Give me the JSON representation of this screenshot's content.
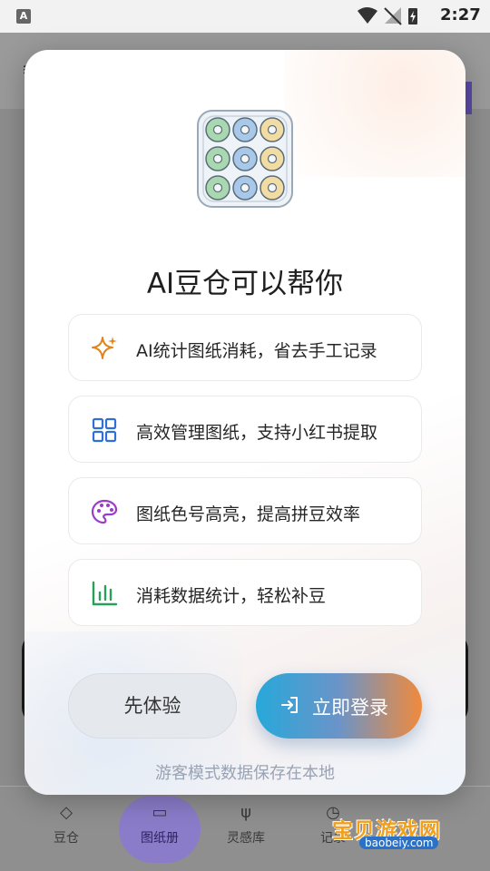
{
  "status_bar": {
    "app_indicator": "A",
    "time": "2:27"
  },
  "modal": {
    "title": "AI豆仓可以帮你",
    "features": [
      {
        "text": "AI统计图纸消耗，省去手工记录",
        "icon": "sparkle-icon",
        "color": "#e0851b"
      },
      {
        "text": "高效管理图纸，支持小红书提取",
        "icon": "grid-icon",
        "color": "#2f6fd6"
      },
      {
        "text": "图纸色号高亮，提高拼豆效率",
        "icon": "palette-icon",
        "color": "#9a3cc8"
      },
      {
        "text": "消耗数据统计，轻松补豆",
        "icon": "bar-chart-icon",
        "color": "#29a05a"
      }
    ],
    "trial_button": "先体验",
    "login_button": "立即登录",
    "guest_note": "游客模式数据保存在本地"
  },
  "bottom_nav": {
    "items": [
      {
        "label": "豆仓"
      },
      {
        "label": "图纸册"
      },
      {
        "label": "灵感库"
      },
      {
        "label": "记录"
      }
    ]
  },
  "watermark": {
    "name": "宝贝游戏网",
    "url": "baobeiy.com"
  },
  "colors": {
    "login_gradient_start": "#27a8da",
    "login_gradient_end": "#f08a3c",
    "nav_active": "#8b7cc9"
  }
}
